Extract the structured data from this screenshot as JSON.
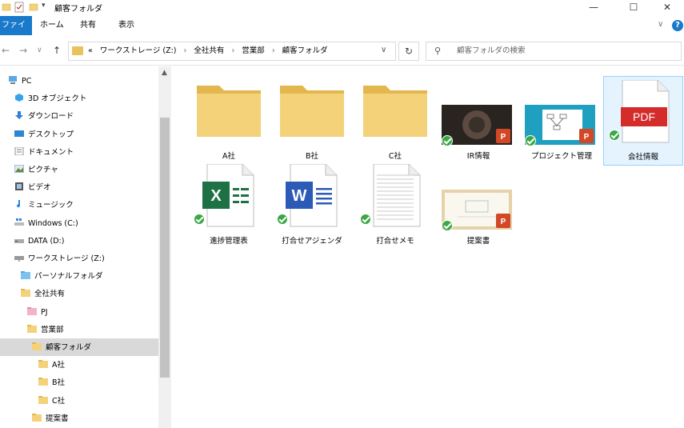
{
  "window": {
    "title": "顧客フォルダ",
    "quick_access_dropdown": "▾",
    "controls": {
      "minimize": "—",
      "maximize": "☐",
      "close": "✕"
    }
  },
  "ribbon": {
    "tabs": [
      {
        "label": "ファイル",
        "active": true
      },
      {
        "label": "ホーム",
        "active": false
      },
      {
        "label": "共有",
        "active": false
      },
      {
        "label": "表示",
        "active": false
      }
    ],
    "collapse": "∨",
    "help": "?"
  },
  "nav": {
    "back": "←",
    "forward": "→",
    "recent": "∨",
    "up": "↑",
    "address": {
      "prefix": "«",
      "crumbs": [
        "ワークストレージ (Z:)",
        "全社共有",
        "営業部",
        "顧客フォルダ"
      ],
      "separator": "›",
      "dropdown": "∨"
    },
    "refresh": "↻",
    "search_placeholder": "顧客フォルダの検索"
  },
  "tree": [
    {
      "label": "PC",
      "icon": "pc-icon",
      "indent": 0
    },
    {
      "label": "3D オブジェクト",
      "icon": "3d-objects-icon",
      "indent": 1
    },
    {
      "label": "ダウンロード",
      "icon": "download-icon",
      "indent": 1
    },
    {
      "label": "デスクトップ",
      "icon": "desktop-icon",
      "indent": 1
    },
    {
      "label": "ドキュメント",
      "icon": "documents-icon",
      "indent": 1
    },
    {
      "label": "ピクチャ",
      "icon": "pictures-icon",
      "indent": 1
    },
    {
      "label": "ビデオ",
      "icon": "video-icon",
      "indent": 1
    },
    {
      "label": "ミュージック",
      "icon": "music-icon",
      "indent": 1
    },
    {
      "label": "Windows (C:)",
      "icon": "windows-drive-icon",
      "indent": 1
    },
    {
      "label": "DATA (D:)",
      "icon": "drive-icon",
      "indent": 1
    },
    {
      "label": "ワークストレージ (Z:)",
      "icon": "network-drive-icon",
      "indent": 1
    },
    {
      "label": "パーソナルフォルダ",
      "icon": "folder-blue-icon",
      "indent": 2
    },
    {
      "label": "全社共有",
      "icon": "folder-icon",
      "indent": 2
    },
    {
      "label": "PJ",
      "icon": "folder-pink-icon",
      "indent": 3
    },
    {
      "label": "営業部",
      "icon": "folder-icon",
      "indent": 3
    },
    {
      "label": "顧客フォルダ",
      "icon": "folder-icon",
      "indent": 4,
      "selected": true
    },
    {
      "label": "A社",
      "icon": "folder-icon",
      "indent": 5
    },
    {
      "label": "B社",
      "icon": "folder-icon",
      "indent": 5
    },
    {
      "label": "C社",
      "icon": "folder-icon",
      "indent": 5
    },
    {
      "label": "提案書",
      "icon": "folder-icon",
      "indent": 4
    }
  ],
  "files": [
    {
      "label": "A社",
      "type": "folder",
      "synced": false
    },
    {
      "label": "B社",
      "type": "folder",
      "synced": false
    },
    {
      "label": "C社",
      "type": "folder",
      "synced": false
    },
    {
      "label": "IR情報",
      "type": "pptx-dark",
      "synced": true
    },
    {
      "label": "プロジェクト管理",
      "type": "pptx-diagram",
      "synced": true
    },
    {
      "label": "会社情報",
      "type": "pdf",
      "synced": true,
      "selected": true,
      "badge": "PDF"
    },
    {
      "label": "進捗管理表",
      "type": "xlsx",
      "synced": true,
      "badge": "X"
    },
    {
      "label": "打合せアジェンダ",
      "type": "docx",
      "synced": true,
      "badge": "W"
    },
    {
      "label": "打合せメモ",
      "type": "txt",
      "synced": true
    },
    {
      "label": "提案書",
      "type": "pptx-board",
      "synced": true
    }
  ],
  "colors": {
    "accent": "#1979ca",
    "folder": "#f3d27a",
    "folder_dark": "#e3b64e",
    "selection": "#e5f3ff",
    "sync_check": "#3aa845",
    "pdf_red": "#d42b2b",
    "excel_green": "#1e7145",
    "word_blue": "#2b5bb7",
    "ppt_orange": "#d24726"
  }
}
